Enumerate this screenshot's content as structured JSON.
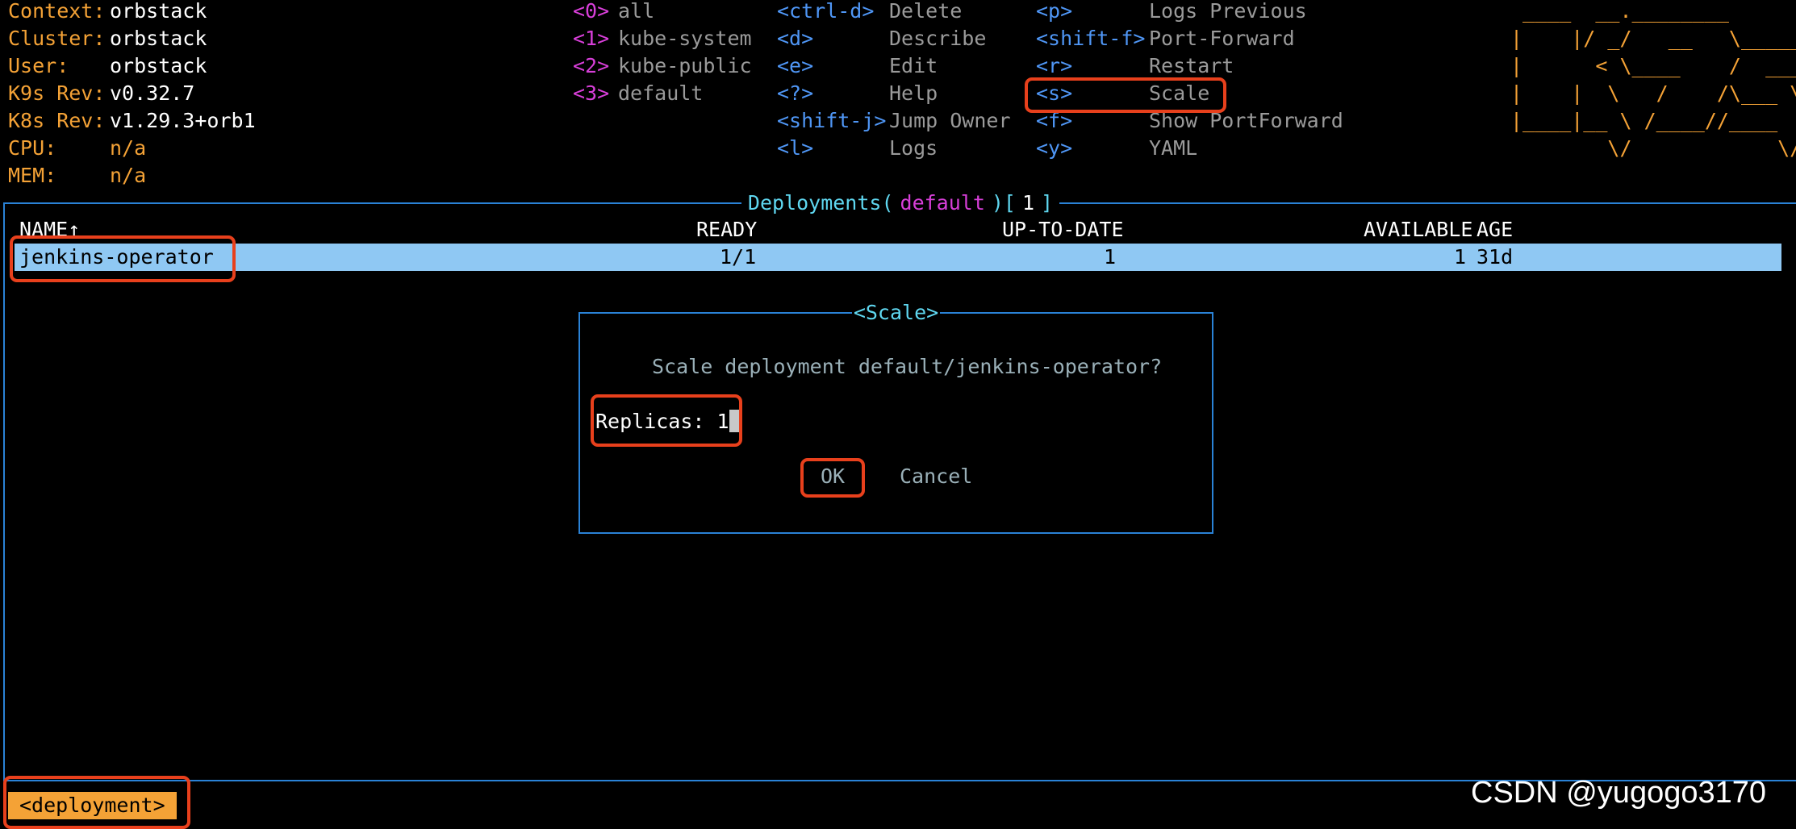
{
  "info": {
    "context_label": "Context:",
    "context_value": "orbstack",
    "cluster_label": "Cluster:",
    "cluster_value": "orbstack",
    "user_label": "User:",
    "user_value": "orbstack",
    "k9s_rev_label": "K9s Rev:",
    "k9s_rev_value": "v0.32.7",
    "k8s_rev_label": "K8s Rev:",
    "k8s_rev_value": "v1.29.3+orb1",
    "cpu_label": "CPU:",
    "cpu_value": "n/a",
    "mem_label": "MEM:",
    "mem_value": "n/a"
  },
  "namespaces": [
    {
      "key": "<0>",
      "name": "all"
    },
    {
      "key": "<1>",
      "name": "kube-system"
    },
    {
      "key": "<2>",
      "name": "kube-public"
    },
    {
      "key": "<3>",
      "name": "default"
    }
  ],
  "commands_col1": [
    {
      "key": "<ctrl-d>",
      "desc": "Delete"
    },
    {
      "key": "<d>",
      "desc": "Describe"
    },
    {
      "key": "<e>",
      "desc": "Edit"
    },
    {
      "key": "<?>",
      "desc": "Help"
    },
    {
      "key": "<shift-j>",
      "desc": "Jump Owner"
    },
    {
      "key": "<l>",
      "desc": "Logs"
    }
  ],
  "commands_col2": [
    {
      "key": "<p>",
      "desc": "Logs Previous"
    },
    {
      "key": "<shift-f>",
      "desc": "Port-Forward"
    },
    {
      "key": "<r>",
      "desc": "Restart"
    },
    {
      "key": "<s>",
      "desc": "Scale"
    },
    {
      "key": "<f>",
      "desc": "Show PortForward"
    },
    {
      "key": "<y>",
      "desc": "YAML"
    }
  ],
  "logo_lines": [
    " ____  __.________",
    "|    |/ _/   __   \\______",
    "|      < \\____    /  ___/",
    "|    |  \\   /    /\\___ \\",
    "|____|__ \\ /____//____  >",
    "        \\/            \\/"
  ],
  "view": {
    "title_prefix": "Deployments(",
    "namespace": "default",
    "title_mid": ")[",
    "count": "1",
    "title_suffix": "]"
  },
  "table": {
    "headers": {
      "name": "NAME↑",
      "ready": "READY",
      "up_to_date": "UP-TO-DATE",
      "available": "AVAILABLE",
      "age": "AGE"
    },
    "rows": [
      {
        "name": "jenkins-operator",
        "ready": "1/1",
        "up_to_date": "1",
        "available": "1",
        "age": "31d"
      }
    ]
  },
  "dialog": {
    "title": "<Scale>",
    "question": "Scale deployment default/jenkins-operator?",
    "replicas_label": "Replicas:",
    "replicas_value": "1",
    "ok_label": "OK",
    "cancel_label": "Cancel"
  },
  "breadcrumb": "<deployment>",
  "watermark": "CSDN @yugogo3170",
  "colors": {
    "background": "#000000",
    "label_orange": "#f4a236",
    "key_blue": "#4f96f5",
    "key_magenta": "#d83fd9",
    "frame_blue": "#2a82d6",
    "selected_row": "#8fc8f3",
    "highlight_red": "#e8401c",
    "title_cyan": "#5fd7f0"
  }
}
